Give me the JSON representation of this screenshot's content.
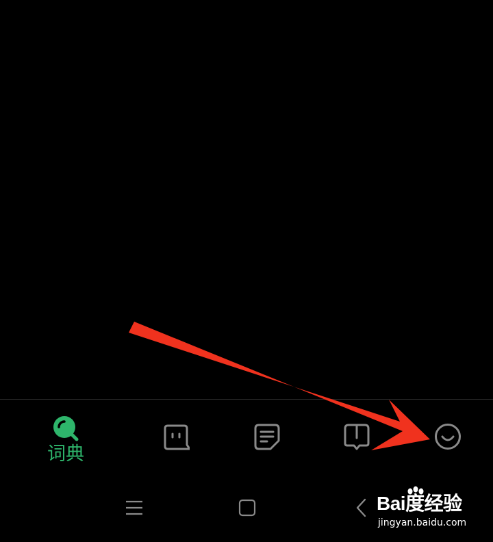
{
  "colors": {
    "background": "#000000",
    "accent_green": "#2eb56b",
    "icon_gray": "#8a8a8a",
    "arrow_red": "#f0321e",
    "divider": "#2b2b2b"
  },
  "tab_bar": {
    "tabs": [
      {
        "id": "dictionary",
        "label": "词典",
        "icon": "search-icon",
        "active": true
      },
      {
        "id": "chat",
        "label": "",
        "icon": "chat-bubble-icon",
        "active": false
      },
      {
        "id": "notes",
        "label": "",
        "icon": "notes-icon",
        "active": false
      },
      {
        "id": "book",
        "label": "",
        "icon": "book-icon",
        "active": false
      },
      {
        "id": "me",
        "label": "",
        "icon": "smiley-icon",
        "active": false
      }
    ]
  },
  "nav_bar": {
    "buttons": [
      {
        "id": "menu",
        "icon": "menu-icon"
      },
      {
        "id": "home",
        "icon": "home-square-icon"
      },
      {
        "id": "back",
        "icon": "back-chevron-icon"
      }
    ]
  },
  "annotation": {
    "icon": "red-arrow-icon",
    "points_to": "me"
  },
  "watermark": {
    "brand": "Bai度经验",
    "domain": "jingyan.baidu.com",
    "icon": "paw-icon"
  }
}
